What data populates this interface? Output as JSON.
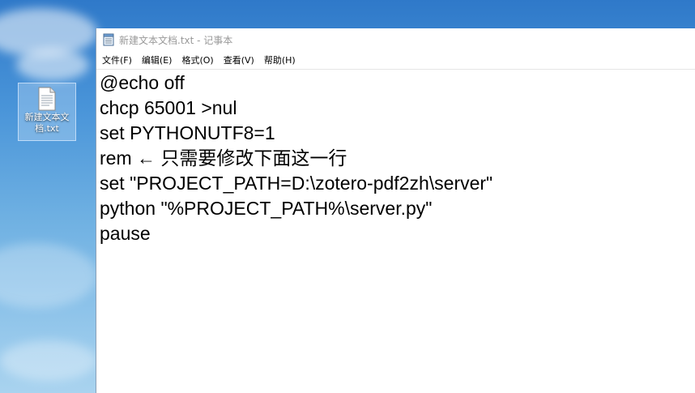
{
  "desktop": {
    "icon_label": "新建文本文档.txt",
    "icon": "text-file-icon"
  },
  "window": {
    "title": "新建文本文档.txt - 记事本",
    "app_icon": "notepad-icon"
  },
  "menu": {
    "items": [
      {
        "label": "文件(F)"
      },
      {
        "label": "编辑(E)"
      },
      {
        "label": "格式(O)"
      },
      {
        "label": "查看(V)"
      },
      {
        "label": "帮助(H)"
      }
    ]
  },
  "editor": {
    "lines": [
      "@echo off",
      "chcp 65001 >nul",
      "set PYTHONUTF8=1",
      "rem ← 只需要修改下面这一行",
      "set \"PROJECT_PATH=D:\\zotero-pdf2zh\\server\"",
      "python \"%PROJECT_PATH%\\server.py\"",
      "pause"
    ]
  }
}
